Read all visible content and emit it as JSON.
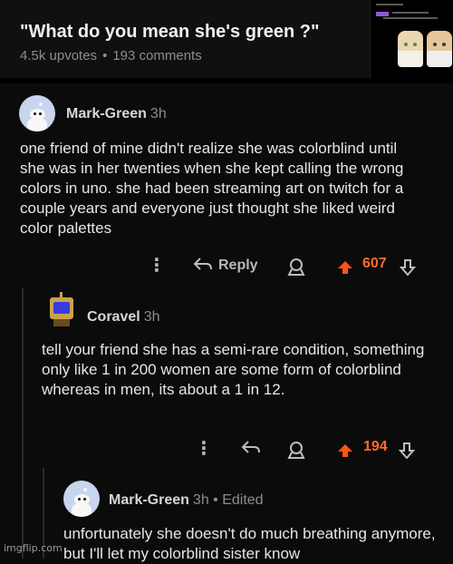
{
  "post": {
    "title": "\"What do you mean she's green ?\"",
    "upvotes": "4.5k upvotes",
    "separator": "•",
    "comments": "193 comments"
  },
  "comments": [
    {
      "username": "Mark-Green",
      "time": "3h",
      "body": "one friend of mine didn't realize she was colorblind until she was in her twenties when she kept calling the wrong colors in uno. she had been streaming art on twitch for a couple years and everyone just thought she liked weird color palettes",
      "reply_label": "Reply",
      "votes": "607"
    },
    {
      "username": "Coravel",
      "time": "3h",
      "body": "tell your friend she has a semi-rare condition, something only like 1 in 200 women are some form of colorblind whereas in men, its about a 1 in 12.",
      "votes": "194"
    },
    {
      "username": "Mark-Green",
      "time": "3h • Edited",
      "body": "unfortunately she doesn't do much breathing anymore, but I'll let my colorblind sister know"
    }
  ],
  "watermark": "imgflip.com",
  "colors": {
    "upvote": "#ff5414",
    "vote_count": "#ff6b2c",
    "background": "#0b0b0b"
  },
  "icons": [
    "more-icon",
    "reply-icon",
    "award-icon",
    "upvote-icon",
    "downvote-icon",
    "snoo-avatar-icon"
  ]
}
